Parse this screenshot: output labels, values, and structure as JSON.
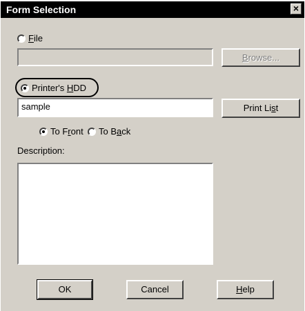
{
  "window": {
    "title": "Form Selection",
    "close_symbol": "×"
  },
  "file_radio": {
    "label_first": "F",
    "label_rest": "ile",
    "checked": false
  },
  "file_path": {
    "value": ""
  },
  "browse_button": {
    "label_first": "B",
    "label_rest": "rowse...",
    "enabled": false
  },
  "printer_radio": {
    "label_prefix": "Printer's ",
    "label_underlined": "H",
    "label_rest": "DD",
    "checked": true
  },
  "form_name": {
    "value": "sample"
  },
  "print_list_button": {
    "label_prefix": "Print Li",
    "label_underlined": "s",
    "label_rest": "t"
  },
  "to_front_radio": {
    "label_prefix": "To F",
    "label_underlined": "r",
    "label_rest": "ont",
    "checked": true
  },
  "to_back_radio": {
    "label_prefix": "To B",
    "label_underlined": "a",
    "label_rest": "ck",
    "checked": false
  },
  "description": {
    "label": "Description:",
    "value": ""
  },
  "buttons": {
    "ok": "OK",
    "cancel": "Cancel",
    "help_underlined": "H",
    "help_rest": "elp"
  }
}
